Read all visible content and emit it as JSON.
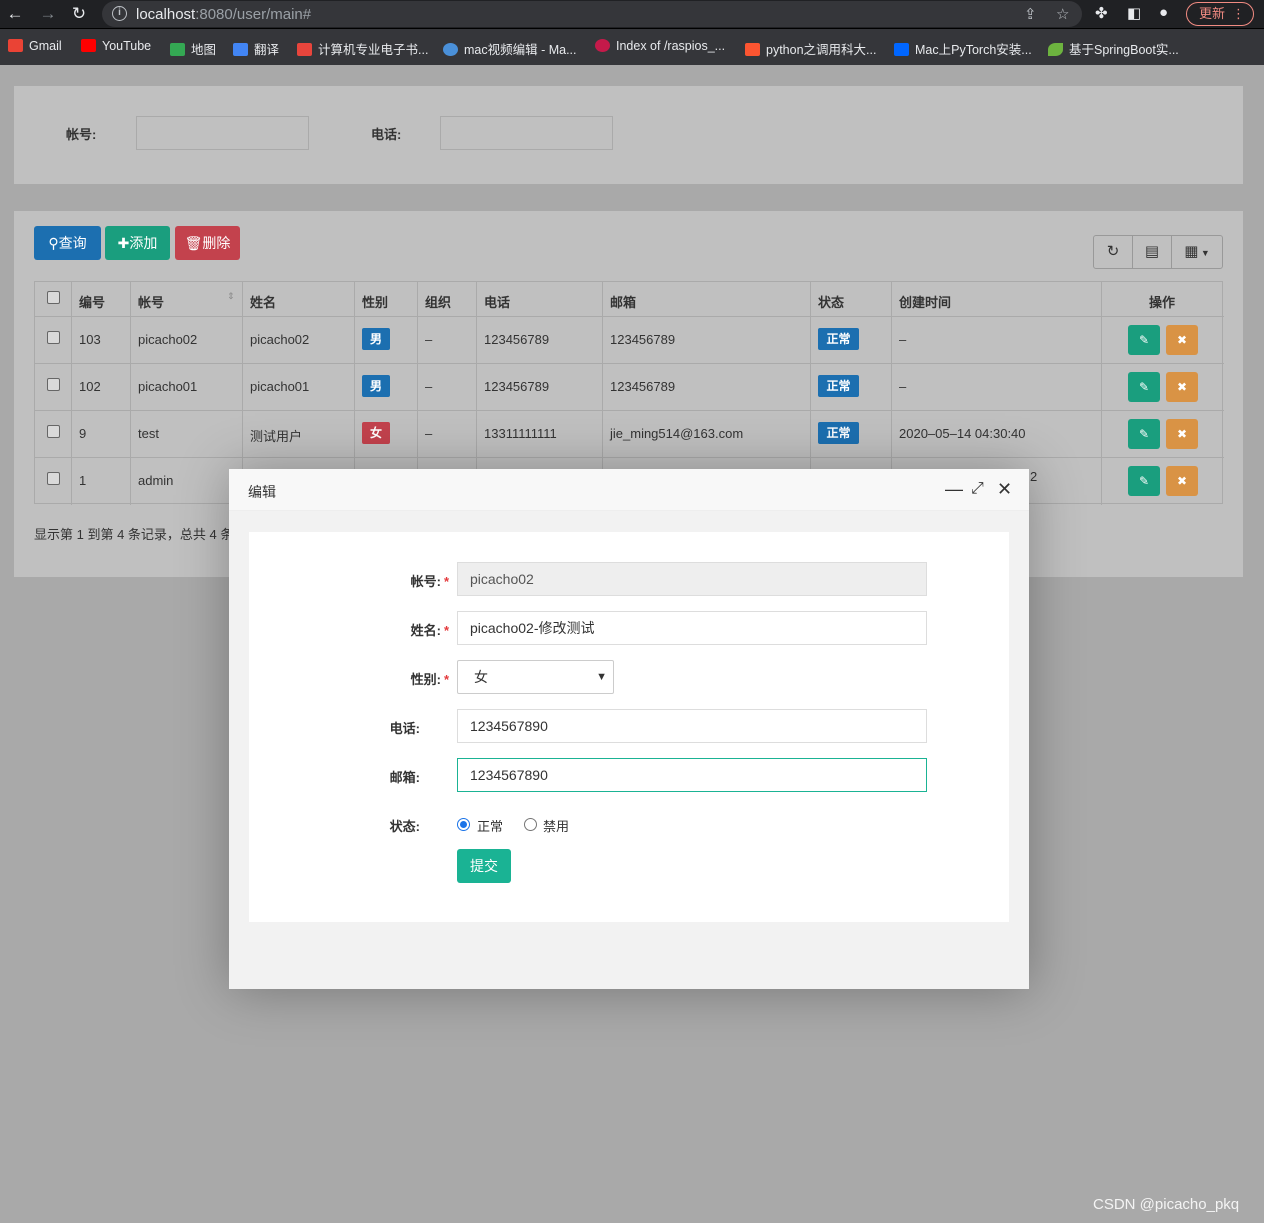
{
  "browser": {
    "url_host": "localhost",
    "url_rest": ":8080/user/main#",
    "update_label": "更新",
    "bookmarks": [
      {
        "label": "Gmail",
        "color": "#ea4335"
      },
      {
        "label": "YouTube",
        "color": "#ff0000"
      },
      {
        "label": "地图",
        "color": "#34a853"
      },
      {
        "label": "翻译",
        "color": "#4285f4"
      },
      {
        "label": "计算机专业电子书...",
        "color": "#e8453c"
      },
      {
        "label": "mac视频编辑 - Ma...",
        "color": "#4a90d9"
      },
      {
        "label": "Index of /raspios_...",
        "color": "#c51a4a"
      },
      {
        "label": "python之调用科大...",
        "color": "#fc5531"
      },
      {
        "label": "Mac上PyTorch安装...",
        "color": "#0066ff"
      },
      {
        "label": "基于SpringBoot实...",
        "color": "#6db33f"
      }
    ]
  },
  "search": {
    "account_label": "帐号:",
    "phone_label": "电话:"
  },
  "toolbar": {
    "query": "查询",
    "add": "添加",
    "delete": "删除"
  },
  "table": {
    "headers": [
      "编号",
      "帐号",
      "姓名",
      "性别",
      "组织",
      "电话",
      "邮箱",
      "状态",
      "创建时间",
      "操作"
    ],
    "rows": [
      {
        "id": "103",
        "account": "picacho02",
        "name": "picacho02",
        "gender": "男",
        "org": "–",
        "phone": "123456789",
        "email": "123456789",
        "status": "正常",
        "created": "–"
      },
      {
        "id": "102",
        "account": "picacho01",
        "name": "picacho01",
        "gender": "男",
        "org": "–",
        "phone": "123456789",
        "email": "123456789",
        "status": "正常",
        "created": "–"
      },
      {
        "id": "9",
        "account": "test",
        "name": "测试用户",
        "gender": "女",
        "org": "–",
        "phone": "13311111111",
        "email": "jie_ming514@163.com",
        "status": "正常",
        "created": "2020–05–14 04:30:40"
      },
      {
        "id": "1",
        "account": "admin",
        "created_tail": "2"
      }
    ],
    "footer": "显示第 1 到第 4 条记录，总共 4 条"
  },
  "modal": {
    "title": "编辑",
    "form": {
      "account_label": "帐号:",
      "account_value": "picacho02",
      "name_label": "姓名:",
      "name_value": "picacho02-修改测试",
      "gender_label": "性别:",
      "gender_value": "女",
      "phone_label": "电话:",
      "phone_value": "1234567890",
      "email_label": "邮箱:",
      "email_value": "1234567890",
      "status_label": "状态:",
      "status_options": [
        "正常",
        "禁用"
      ],
      "status_selected": "正常",
      "required_mark": "*",
      "submit": "提交"
    }
  },
  "watermark": "CSDN @picacho_pkq",
  "colors": {
    "primary": "#1c6fb0",
    "success": "#1a9e7e",
    "danger": "#c3424d",
    "warning": "#d99345",
    "submit": "#1ab394"
  }
}
